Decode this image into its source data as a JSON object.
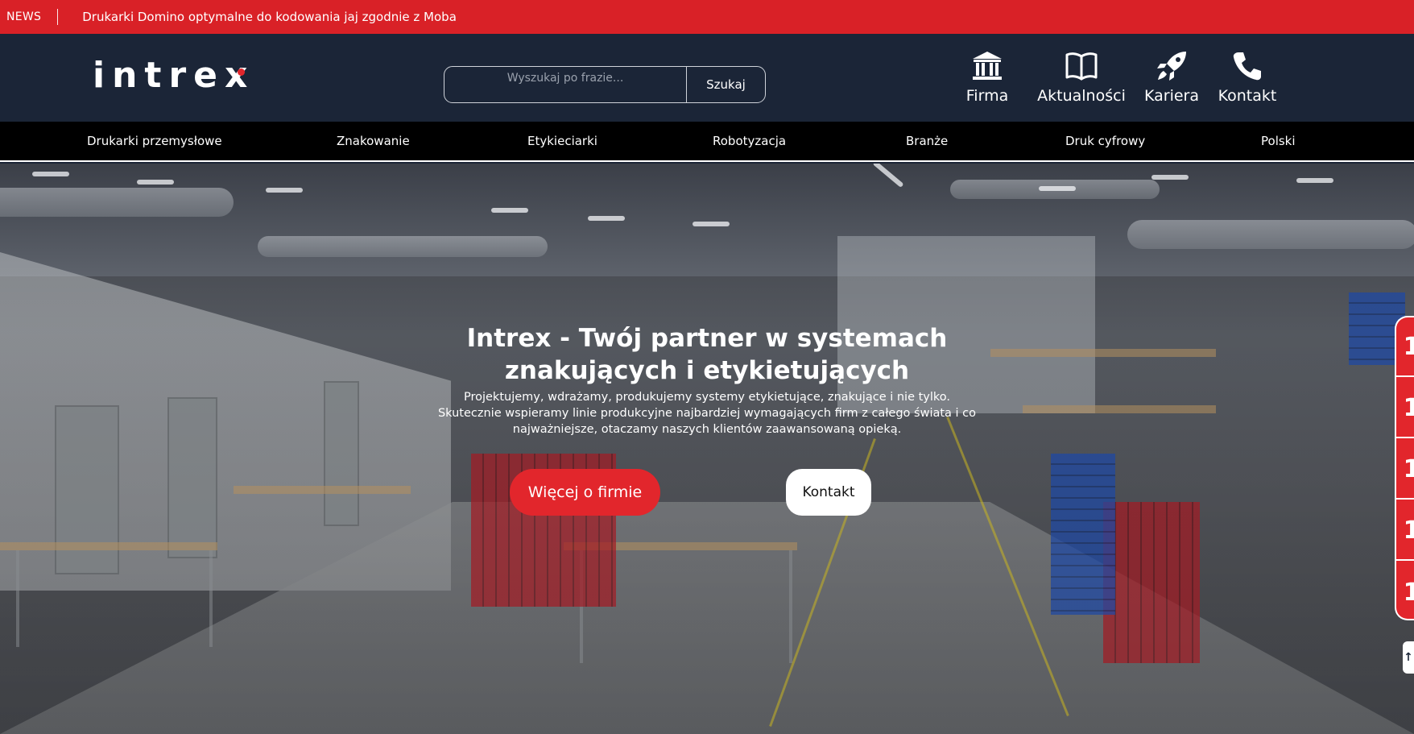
{
  "news": {
    "label": "NEWS",
    "headline": "Drukarki Domino optymalne do kodowania jaj zgodnie z Moba"
  },
  "header": {
    "logo_text": "intrex",
    "search": {
      "placeholder": "Wyszukaj po frazie...",
      "button_label": "Szukaj"
    },
    "nav": [
      {
        "label": "Firma",
        "icon": "bank-icon"
      },
      {
        "label": "Aktualności",
        "icon": "book-icon"
      },
      {
        "label": "Kariera",
        "icon": "rocket-icon"
      },
      {
        "label": "Kontakt",
        "icon": "phone-icon"
      }
    ]
  },
  "main_nav": [
    "Drukarki przemysłowe",
    "Znakowanie",
    "Etykieciarki",
    "Robotyzacja",
    "Branże",
    "Druk cyfrowy",
    "Polski"
  ],
  "hero": {
    "title": "Intrex - Twój partner w systemach znakujących i etykietujących",
    "text": "Projektujemy, wdrażamy, produkujemy systemy etykietujące, znakujące i nie tylko. Skutecznie wspieramy linie produkcyjne najbardziej wymagających firm z całego świata i co najważniejsze, otaczamy naszych klientów zaawansowaną opieką.",
    "primary_button": "Więcej o firmie",
    "secondary_button": "Kontakt"
  },
  "side_tabs": [
    "1",
    "1",
    "1",
    "1",
    "1"
  ],
  "scroll_top_glyph": "↑",
  "colors": {
    "accent_red": "#e2262c",
    "header_navy": "#1b2537",
    "nav_black": "#000000"
  }
}
